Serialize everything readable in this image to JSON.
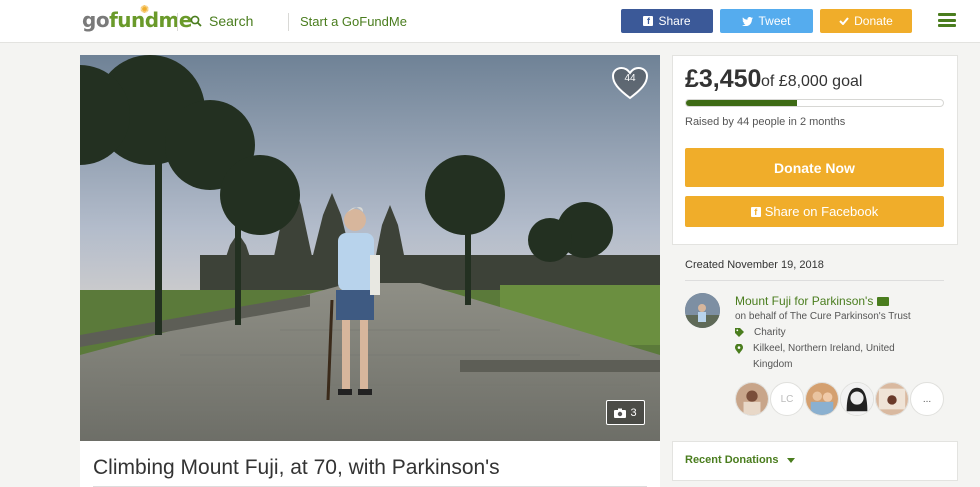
{
  "header": {
    "logo_prefix": "go",
    "logo_suffix": "fundme",
    "search_label": "Search",
    "start_label": "Start a GoFundMe",
    "share_label": "Share",
    "tweet_label": "Tweet",
    "donate_label": "Donate"
  },
  "hero": {
    "heart_count": "44",
    "photo_count": "3"
  },
  "campaign": {
    "title": "Climbing Mount Fuji, at 70, with Parkinson's"
  },
  "donation_panel": {
    "amount": "£3,450",
    "goal": "of £8,000 goal",
    "progress_fraction": 0.43,
    "raised_text": "Raised by 44 people in 2 months",
    "donate_now_label": "Donate Now",
    "share_facebook_label": "Share on Facebook"
  },
  "organizer": {
    "created": "Created November 19, 2018",
    "name": "Mount Fuji for Parkinson's",
    "on_behalf": "on behalf of The Cure Parkinson's Trust",
    "category": "Charity",
    "location": "Kilkeel, Northern Ireland, United Kingdom"
  },
  "donors": {
    "initials": "LC",
    "more": "..."
  },
  "recent_donations": {
    "label": "Recent Donations"
  },
  "colors": {
    "brand_green": "#4a7d1e",
    "progress_green": "#3e6b15",
    "donate_orange": "#f0ad2a",
    "facebook_blue": "#3b5998",
    "twitter_blue": "#55acee"
  }
}
